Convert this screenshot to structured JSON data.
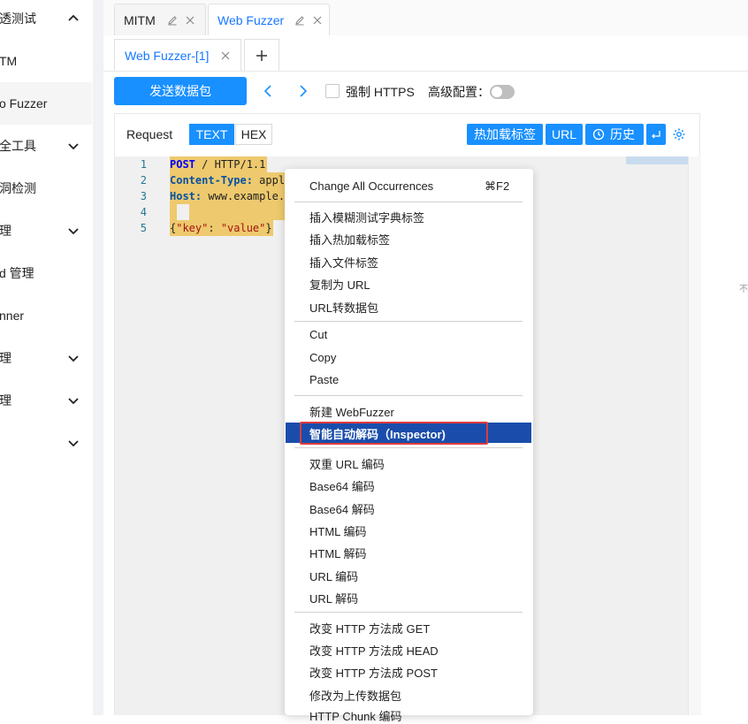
{
  "sidebar": {
    "items": [
      {
        "label": "透测试",
        "chevron": "up"
      },
      {
        "label": "TM",
        "chevron": ""
      },
      {
        "label": "o Fuzzer",
        "chevron": ""
      },
      {
        "label": "全工具",
        "chevron": "down"
      },
      {
        "label": "洞检测",
        "chevron": ""
      },
      {
        "label": "理",
        "chevron": "down"
      },
      {
        "label": "d 管理",
        "chevron": ""
      },
      {
        "label": "nner",
        "chevron": ""
      },
      {
        "label": "理",
        "chevron": "down"
      },
      {
        "label": "理",
        "chevron": "down"
      },
      {
        "label": "",
        "chevron": "down"
      }
    ]
  },
  "tabs": [
    {
      "label": "MITM",
      "active": false
    },
    {
      "label": "Web Fuzzer",
      "active": true
    }
  ],
  "subtabs": [
    {
      "label": "Web Fuzzer-[1]"
    }
  ],
  "toolbar": {
    "send_label": "发送数据包",
    "force_https_label": "强制 HTTPS",
    "force_https_checked": false,
    "advanced_label": "高级配置：",
    "advanced_enabled": false
  },
  "request": {
    "title": "Request",
    "mode_text": "TEXT",
    "mode_hex": "HEX",
    "hotload_label": "热加载标签",
    "url_label": "URL",
    "history_label": "历史"
  },
  "editor": {
    "lines": [
      {
        "no": "1",
        "parts": [
          [
            "kw",
            "POST"
          ],
          [
            "plain",
            " / HTTP/1.1"
          ]
        ]
      },
      {
        "no": "2",
        "parts": [
          [
            "key",
            "Content-Type:"
          ],
          [
            "plain",
            " appl"
          ]
        ]
      },
      {
        "no": "3",
        "parts": [
          [
            "key",
            "Host:"
          ],
          [
            "plain",
            " www.example."
          ]
        ]
      },
      {
        "no": "4",
        "parts": [
          [
            "plain",
            ""
          ]
        ]
      },
      {
        "no": "5",
        "parts": [
          [
            "plain",
            "{"
          ],
          [
            "str",
            "\"key\""
          ],
          [
            "plain",
            ": "
          ],
          [
            "str",
            "\"value\""
          ],
          [
            "plain",
            "}"
          ]
        ]
      }
    ]
  },
  "context_menu": {
    "groups": [
      [
        {
          "label": "Change All Occurrences",
          "shortcut": "⌘F2"
        }
      ],
      [
        {
          "label": "插入模糊测试字典标签"
        },
        {
          "label": "插入热加载标签"
        },
        {
          "label": "插入文件标签"
        },
        {
          "label": "复制为 URL"
        },
        {
          "label": "URL转数据包"
        }
      ],
      [
        {
          "label": "Cut"
        },
        {
          "label": "Copy"
        },
        {
          "label": "Paste"
        }
      ],
      [
        {
          "label": "新建 WebFuzzer"
        },
        {
          "label": "智能自动解码（Inspector)",
          "highlighted": true
        }
      ],
      [
        {
          "label": "双重 URL 编码"
        },
        {
          "label": "Base64 编码"
        },
        {
          "label": "Base64 解码"
        },
        {
          "label": "HTML 编码"
        },
        {
          "label": "HTML 解码"
        },
        {
          "label": "URL 编码"
        },
        {
          "label": "URL 解码"
        }
      ],
      [
        {
          "label": "改变 HTTP 方法成 GET"
        },
        {
          "label": "改变 HTTP 方法成 HEAD"
        },
        {
          "label": "改变 HTTP 方法成 POST"
        },
        {
          "label": "修改为上传数据包"
        },
        {
          "label": "HTTP Chunk 编码"
        }
      ]
    ]
  },
  "edge_text": "不",
  "colors": {
    "accent": "#1890ff",
    "menu_highlight": "#1a4dab",
    "annotation_box": "#e03b3b"
  }
}
